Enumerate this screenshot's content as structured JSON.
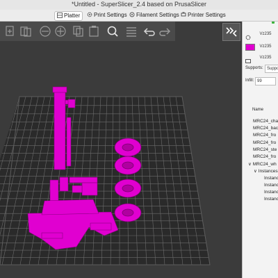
{
  "window": {
    "title": "*Untitled - SuperSlicer_2.4  based on PrusaSlicer"
  },
  "tabs": [
    {
      "label": "Platter",
      "active": true
    },
    {
      "label": "Print Settings",
      "active": false
    },
    {
      "label": "Filament Settings",
      "active": false
    },
    {
      "label": "Printer Settings",
      "active": false
    }
  ],
  "toolbar": {
    "icons": [
      "add-icon",
      "delete-icon",
      "delete-all-icon",
      "arrange-icon",
      "copy-icon",
      "paste-icon",
      "add-instance-icon",
      "remove-instance-icon",
      "split-objects-icon",
      "split-parts-icon",
      "search-icon",
      "layers-icon",
      "undo-icon",
      "redo-icon"
    ],
    "collapse_icon": "collapse-sidebar-icon"
  },
  "sidebar": {
    "presets": [
      {
        "icon": "gear-icon",
        "value": "Vz235"
      },
      {
        "icon": "filament-swatch",
        "value": "Vz235",
        "color": "#e000d0"
      },
      {
        "icon": "printer-icon",
        "value": "Vz235"
      }
    ],
    "supports_label": "Supports:",
    "supports_value": "Suppor",
    "infill_label": "Infill:",
    "infill_value": "99",
    "list_header": "Name",
    "objects": [
      {
        "label": "MRC24_cha",
        "indent": 0
      },
      {
        "label": "MRC24_bac",
        "indent": 0
      },
      {
        "label": "MRC24_fro",
        "indent": 0
      },
      {
        "label": "MRC24_fro",
        "indent": 0
      },
      {
        "label": "MRC24_ste",
        "indent": 0
      },
      {
        "label": "MRC24_fro",
        "indent": 0
      },
      {
        "label": "MRC24_wh",
        "indent": 0,
        "expanded": true
      },
      {
        "label": "Instances",
        "indent": 1,
        "expanded": true
      },
      {
        "label": "Instance",
        "indent": 2
      },
      {
        "label": "Instance",
        "indent": 2
      },
      {
        "label": "Instance",
        "indent": 2
      },
      {
        "label": "Instance",
        "indent": 2
      }
    ]
  },
  "colors": {
    "accent": "#e000d0",
    "bed": "#2a2a2a",
    "grid": "#6d6d6d",
    "viewport": "#3b3b3b"
  }
}
